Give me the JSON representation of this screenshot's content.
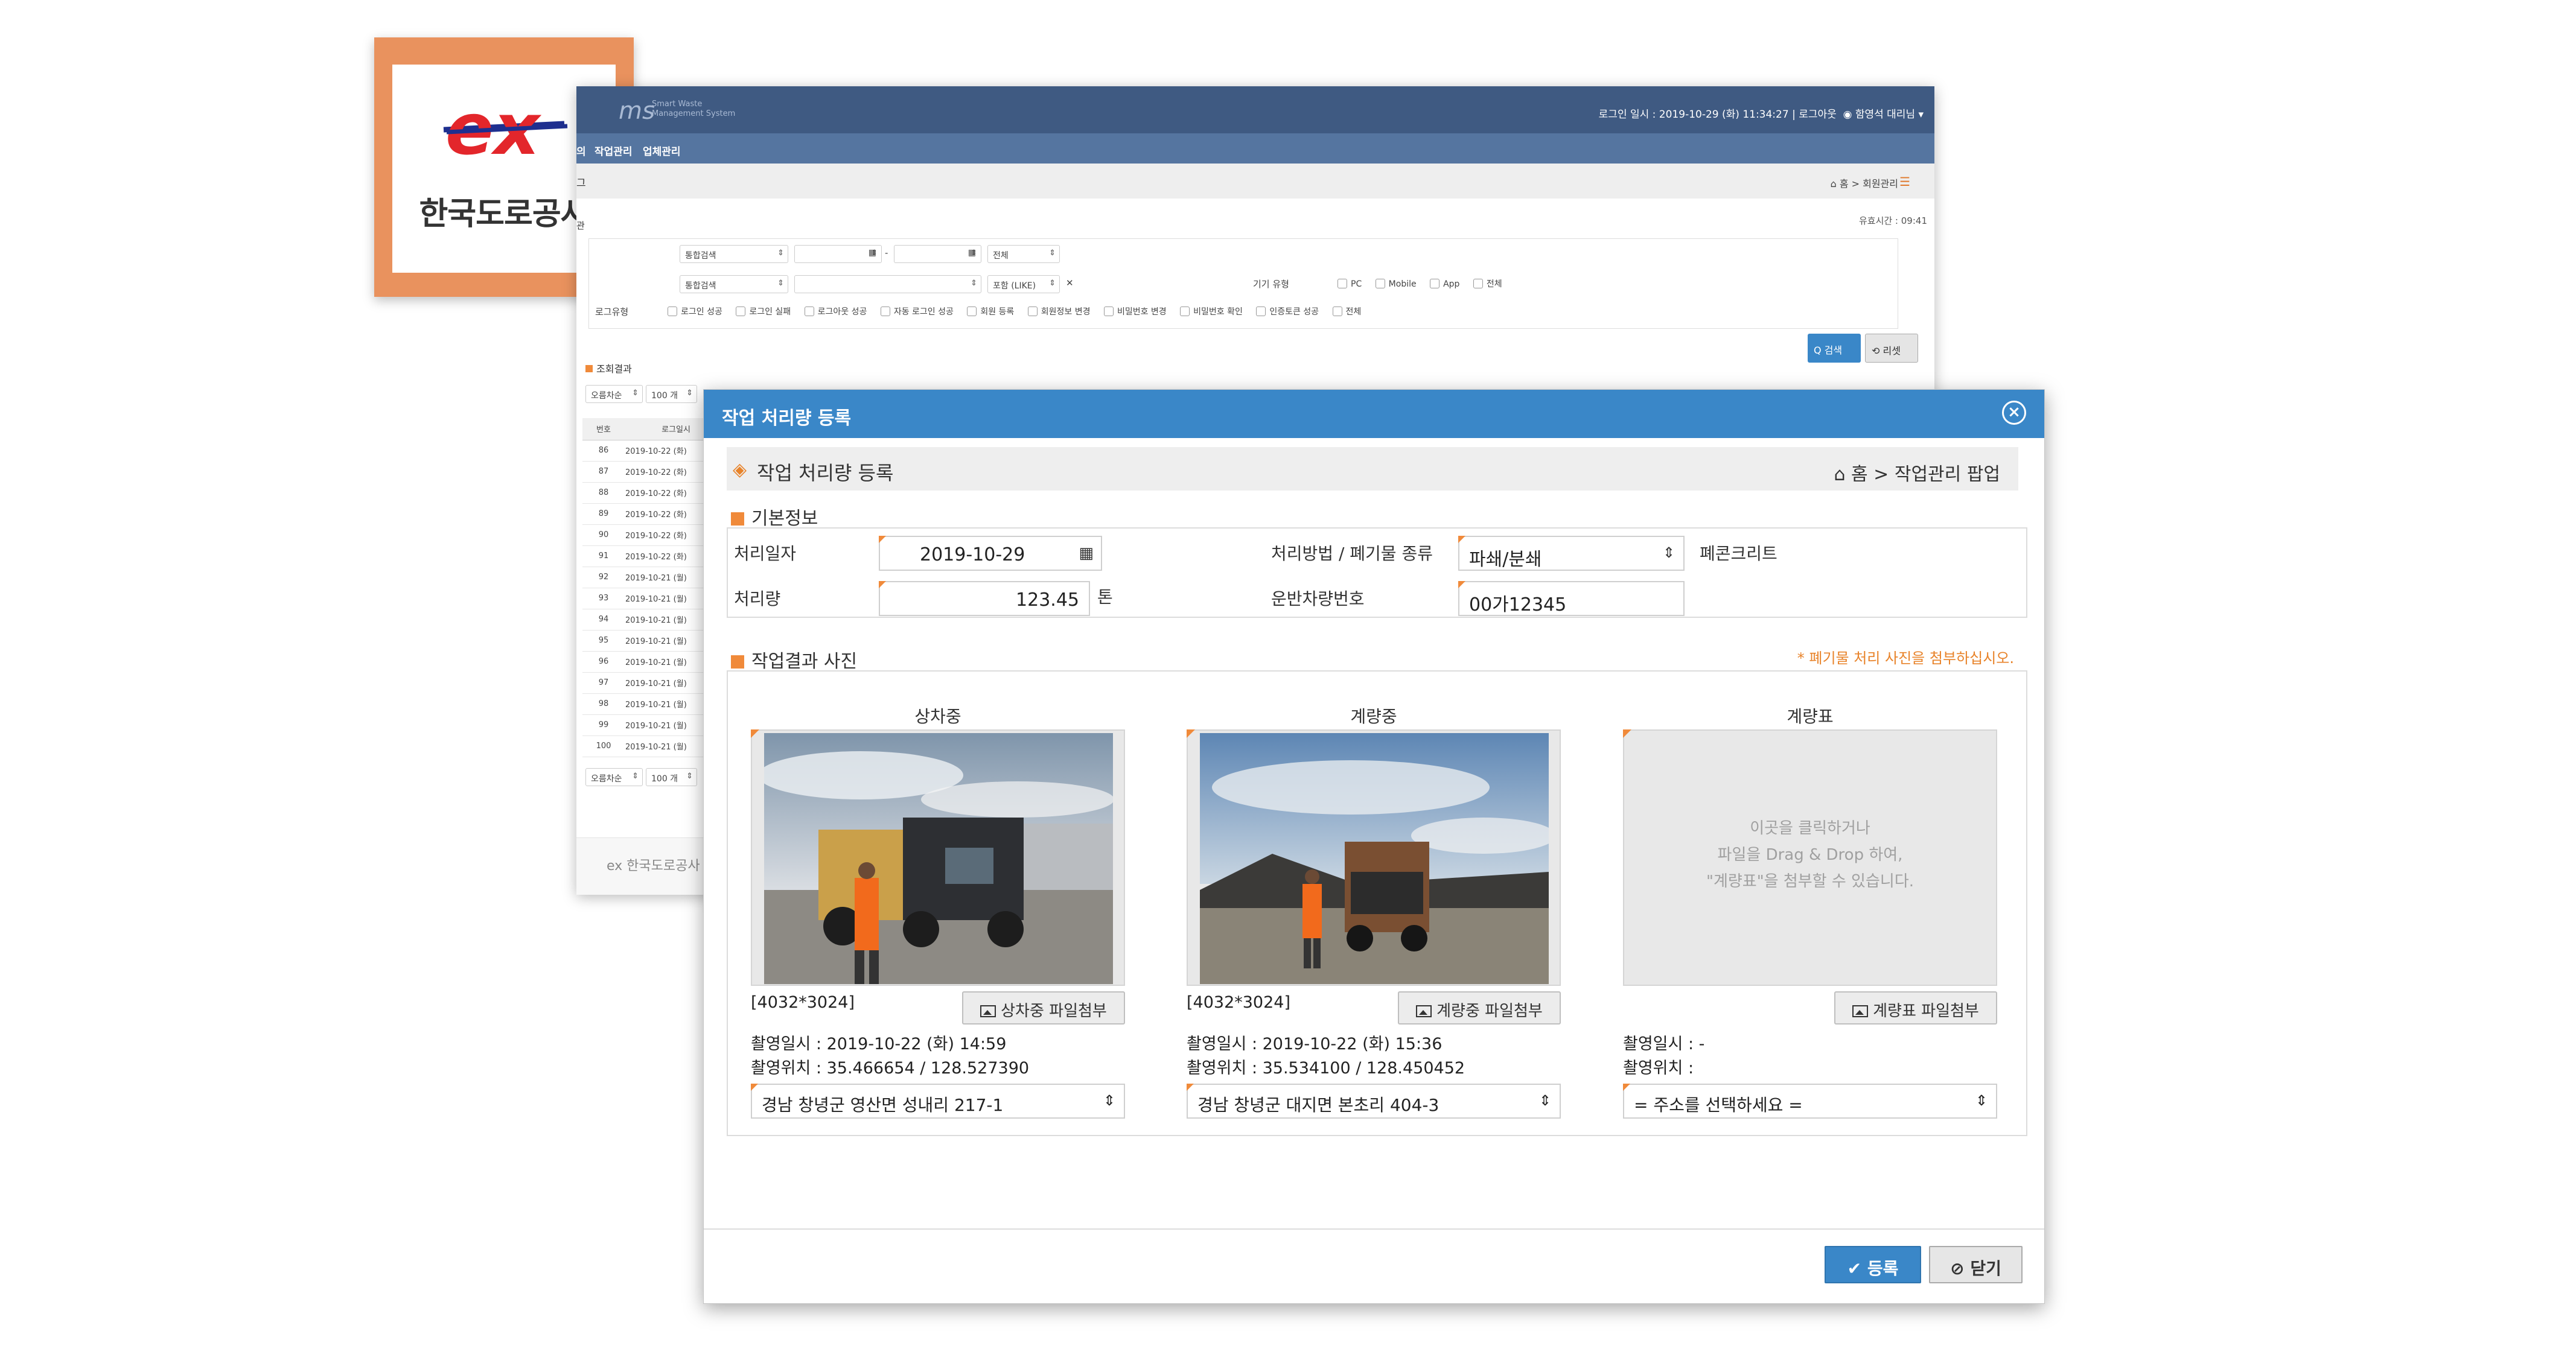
{
  "badge": {
    "logo_text": "ex",
    "org_name": "한국도로공사"
  },
  "bg": {
    "brand": "ms",
    "brand_sub_1": "Smart Waste",
    "brand_sub_2": "Management System",
    "login_info": "로그인 일시 : 2019-10-29 (화) 11:34:27 | 로그아웃",
    "user": "◉ 함영석 대리님 ▾",
    "nav_prefix": "의",
    "nav_1": "작업관리",
    "nav_2": "업체관리",
    "crumbbar_tail": "그",
    "crumb": "⌂ 홈 > 회원관리",
    "menu_icon": "☰",
    "left_tail": "관",
    "session": "유효시간 : 09:41",
    "sel_integrated_1": "통합검색",
    "sel_all": "전체",
    "sel_integrated_2": "통합검색",
    "sel_include": "포함 (LIKE)",
    "clear": "✕",
    "device_label": "기기 유형",
    "devices": [
      "PC",
      "Mobile",
      "App",
      "전체"
    ],
    "log_label": "로그유형",
    "log_types": [
      "로그인 성공",
      "로그인 실패",
      "로그아웃 성공",
      "자동 로그인 성공",
      "회원 등록",
      "회원정보 변경",
      "비밀번호 변경",
      "비밀번호 확인",
      "인증토큰 성공",
      "전체"
    ],
    "search_btn": "Q 검색",
    "reset_btn": "⟲ 리셋",
    "results_label": "조회결과",
    "sort_1": "오름차순",
    "size_1": "100 개",
    "sort_2": "오름차순",
    "size_2": "100 개",
    "table_headers": [
      "번호",
      "로그일시"
    ],
    "rows": [
      {
        "no": "86",
        "dt": "2019-10-22 (화)"
      },
      {
        "no": "87",
        "dt": "2019-10-22 (화)"
      },
      {
        "no": "88",
        "dt": "2019-10-22 (화)"
      },
      {
        "no": "89",
        "dt": "2019-10-22 (화)"
      },
      {
        "no": "90",
        "dt": "2019-10-22 (화)"
      },
      {
        "no": "91",
        "dt": "2019-10-22 (화)"
      },
      {
        "no": "92",
        "dt": "2019-10-21 (월)"
      },
      {
        "no": "93",
        "dt": "2019-10-21 (월)"
      },
      {
        "no": "94",
        "dt": "2019-10-21 (월)"
      },
      {
        "no": "95",
        "dt": "2019-10-21 (월)"
      },
      {
        "no": "96",
        "dt": "2019-10-21 (월)"
      },
      {
        "no": "97",
        "dt": "2019-10-21 (월)"
      },
      {
        "no": "98",
        "dt": "2019-10-21 (월)"
      },
      {
        "no": "99",
        "dt": "2019-10-21 (월)"
      },
      {
        "no": "100",
        "dt": "2019-10-21 (월)"
      }
    ],
    "footer": "ex 한국도로공사"
  },
  "modal": {
    "title": "작업 처리량 등록",
    "close": "×",
    "sub_title": "작업 처리량 등록",
    "sub_icon": "◈",
    "crumb": "⌂ 홈 > 작업관리 팝업",
    "section_basic": "기본정보",
    "date_label": "처리일자",
    "date_value": "2019-10-29",
    "amount_label": "처리량",
    "amount_value": "123.45",
    "amount_unit": "톤",
    "method_label": "처리방법 / 폐기물 종류",
    "method_value": "파쇄/분쇄",
    "waste_type": "폐콘크리트",
    "vehicle_label": "운반차량번호",
    "vehicle_value": "00가12345",
    "section_photo": "작업결과 사진",
    "photo_note": "* 폐기물 처리 사진을 첨부하십시오.",
    "photos": [
      {
        "title": "상차중",
        "res": "[4032*3024]",
        "attach": "상차중 파일첨부",
        "shot_time": "촬영일시 :   2019-10-22 (화) 14:59",
        "shot_loc": "촬영위치 : 35.466654 / 128.527390",
        "address": "경남 창녕군 영산면 성내리 217-1"
      },
      {
        "title": "계량중",
        "res": "[4032*3024]",
        "attach": "계량중 파일첨부",
        "shot_time": "촬영일시 :   2019-10-22 (화) 15:36",
        "shot_loc": "촬영위치 : 35.534100 / 128.450452",
        "address": "경남 창녕군 대지면 본초리 404-3"
      },
      {
        "title": "계량표",
        "res": "",
        "attach": "계량표 파일첨부",
        "shot_time": "촬영일시 :  -",
        "shot_loc": "촬영위치 :",
        "address": "= 주소를 선택하세요 ="
      }
    ],
    "drop_hint_1": "이곳을 클릭하거나",
    "drop_hint_2": "파일을 Drag & Drop 하여,",
    "drop_hint_3": "\"계량표\"을 첨부할 수 있습니다.",
    "btn_register": "✔ 등록",
    "btn_close": "⊘ 닫기"
  },
  "colors": {
    "modal_header": "#3a87c8",
    "accent": "#f08a3a",
    "badge_frame": "#e9925e",
    "bg_header": "#3f5a82"
  }
}
